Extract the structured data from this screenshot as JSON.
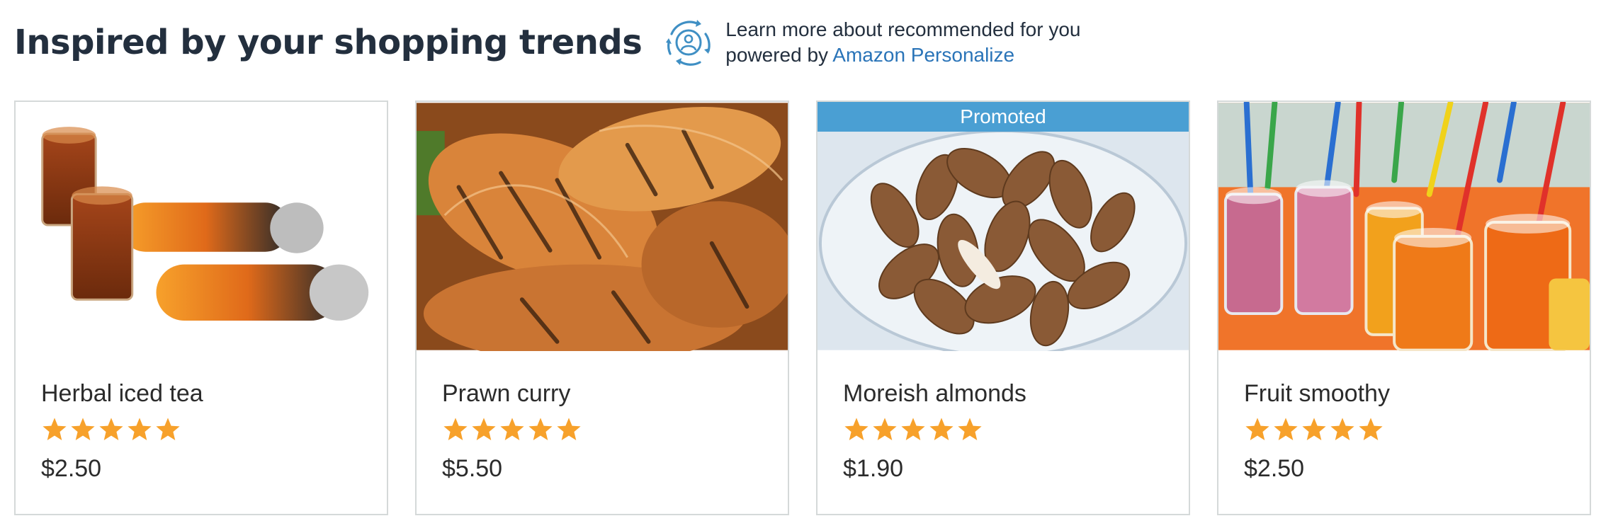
{
  "header": {
    "title": "Inspired by your shopping trends",
    "personalize": {
      "line1": "Learn more about recommended for you",
      "prefix": "powered by",
      "link": "Amazon Personalize"
    }
  },
  "colors": {
    "accent_blue": "#2a74b8",
    "promo_banner": "#4a9fd3",
    "star": "#f7a12b",
    "border": "#d5d9d9"
  },
  "products": [
    {
      "name": "Herbal iced tea",
      "price": "$2.50",
      "rating": 5,
      "max_rating": 5
    },
    {
      "name": "Prawn curry",
      "price": "$5.50",
      "rating": 5,
      "max_rating": 5
    },
    {
      "name": "Moreish almonds",
      "price": "$1.90",
      "rating": 5,
      "max_rating": 5,
      "badge": "Promoted"
    },
    {
      "name": "Fruit smoothy",
      "price": "$2.50",
      "rating": 5,
      "max_rating": 5
    }
  ]
}
